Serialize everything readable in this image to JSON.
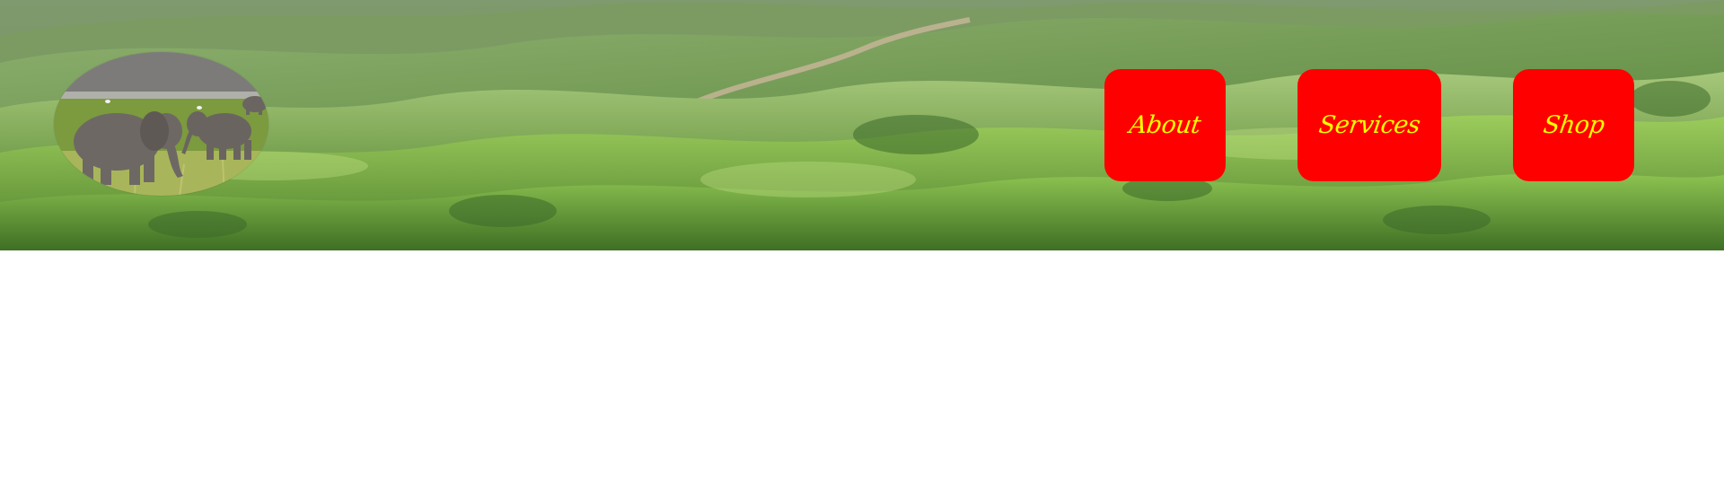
{
  "header": {
    "background": "green-hills-landscape",
    "logo": {
      "image": "elephants-in-grassland-photo"
    }
  },
  "nav": {
    "items": [
      {
        "label": "About"
      },
      {
        "label": "Services"
      },
      {
        "label": "Shop"
      }
    ],
    "button_color": "#ff0000",
    "text_color": "#ffff00"
  }
}
